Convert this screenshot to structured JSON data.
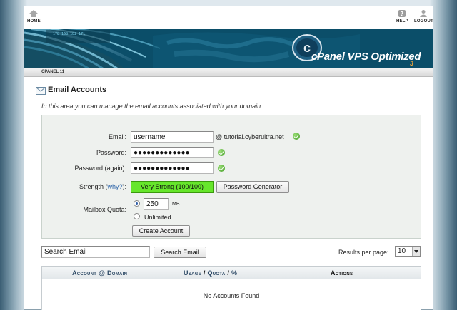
{
  "topbar": {
    "home_label": "HOME",
    "help_label": "HELP",
    "logout_label": "LOGOUT"
  },
  "banner": {
    "brand": "cPanel VPS Optimized",
    "version": "3"
  },
  "breadcrumb": {
    "label": "CPANEL 11"
  },
  "section": {
    "title": "Email Accounts",
    "intro": "In this area you can manage the email accounts associated with your domain."
  },
  "form": {
    "email_label": "Email:",
    "email_value": "username",
    "domain_text": "@ tutorial.cyberultra.net",
    "password_label": "Password:",
    "password_value": "●●●●●●●●●●●●●",
    "password_again_label": "Password (again):",
    "password_again_value": "●●●●●●●●●●●●●",
    "strength_label": "Strength",
    "strength_why": "why?",
    "strength_colon": "):",
    "strength_open": " (",
    "strength_value": "Very Strong (100/100)",
    "password_generator": "Password Generator",
    "quota_label": "Mailbox Quota:",
    "quota_value": "250",
    "quota_unit": "MB",
    "unlimited_label": "Unlimited",
    "create_button": "Create Account"
  },
  "search": {
    "input_value": "Search Email",
    "button": "Search Email",
    "per_page_label": "Results per page:",
    "per_page_value": "10"
  },
  "table": {
    "col_account": "Account",
    "col_at": "@",
    "col_domain": "Domain",
    "col_usage": "Usage",
    "col_slash1": "/",
    "col_quota": "Quota",
    "col_slash2": "/",
    "col_percent": "%",
    "col_actions": "Actions",
    "empty": "No Accounts Found"
  }
}
